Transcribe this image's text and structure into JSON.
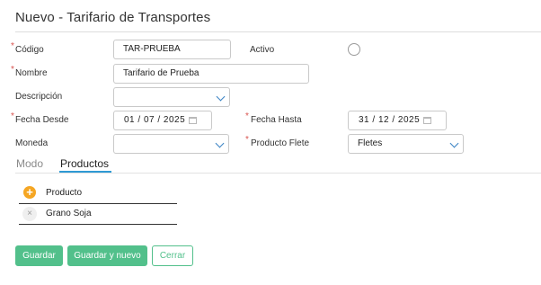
{
  "header": {
    "title": "Nuevo - Tarifario de Transportes"
  },
  "form": {
    "codigo": {
      "label": "Código",
      "value": "TAR-PRUEBA",
      "required": "*"
    },
    "activo": {
      "label": "Activo"
    },
    "nombre": {
      "label": "Nombre",
      "value": "Tarifario de Prueba",
      "required": "*"
    },
    "descripcion": {
      "label": "Descripción",
      "value": ""
    },
    "fecha_desde": {
      "label": "Fecha Desde",
      "value": "01 / 07 / 2025",
      "required": "*"
    },
    "fecha_hasta": {
      "label": "Fecha Hasta",
      "value": "31 / 12 / 2025",
      "required": "*"
    },
    "moneda": {
      "label": "Moneda",
      "value": ""
    },
    "producto_flete": {
      "label": "Producto Flete",
      "value": "Fletes",
      "required": "*"
    }
  },
  "tabs": [
    {
      "label": "Modo",
      "active": false
    },
    {
      "label": "Productos",
      "active": true
    }
  ],
  "productos_grid": {
    "header": "Producto",
    "rows": [
      {
        "label": "Grano Soja"
      }
    ]
  },
  "actions": {
    "save": "Guardar",
    "save_new": "Guardar y nuevo",
    "close": "Cerrar"
  },
  "colors": {
    "accent": "#52c08b",
    "tab_active": "#2e9ad4",
    "required": "#d9534f",
    "add_icon": "#f5a623"
  },
  "icons": {
    "add": "plus-circle-icon",
    "remove": "close-icon",
    "calendar": "calendar-icon",
    "dropdown": "chevron-down-icon"
  }
}
